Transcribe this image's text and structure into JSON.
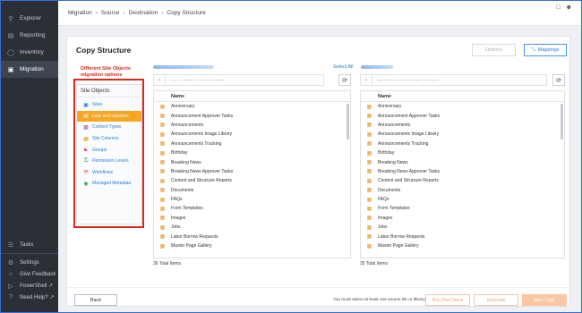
{
  "sidebar": {
    "top_items": [
      {
        "label": "Explorer",
        "icon": "search-icon"
      },
      {
        "label": "Reporting",
        "icon": "report-icon"
      },
      {
        "label": "Inventory",
        "icon": "inventory-icon"
      },
      {
        "label": "Migration",
        "icon": "migration-icon"
      }
    ],
    "bottom_items": [
      {
        "label": "Tasks",
        "icon": "tasks-icon"
      },
      {
        "label": "Settings",
        "icon": "gear-icon"
      },
      {
        "label": "Give Feedback",
        "icon": "feedback-icon"
      },
      {
        "label": "PowerShell ↗",
        "icon": "powershell-icon"
      },
      {
        "label": "Need Help? ↗",
        "icon": "help-icon"
      }
    ]
  },
  "breadcrumb": [
    "Migration",
    "Source",
    "Destination",
    "Copy Structure"
  ],
  "page": {
    "title": "Copy Structure",
    "options_label": "Options",
    "mappings_label": "Mappings",
    "annotation_line1": "Different Site Objects",
    "annotation_line2": "migration options"
  },
  "site_objects": {
    "header": "Site Objects",
    "items": [
      {
        "label": "Sites",
        "icon": "sites-icon"
      },
      {
        "label": "Lists and Libraries",
        "icon": "lists-icon"
      },
      {
        "label": "Content Types",
        "icon": "content-types-icon"
      },
      {
        "label": "Site Columns",
        "icon": "site-columns-icon"
      },
      {
        "label": "Groups",
        "icon": "groups-icon"
      },
      {
        "label": "Permission Levels",
        "icon": "key-icon"
      },
      {
        "label": "Workflows",
        "icon": "workflow-icon"
      },
      {
        "label": "Managed Metadata",
        "icon": "tag-icon"
      }
    ]
  },
  "source": {
    "select_all": "Select All",
    "column_header": "Name",
    "items": [
      "Anniversary",
      "Announcement Approver Tasks",
      "Announcements",
      "Announcements Image Library",
      "Announcements Tracking",
      "Birthday",
      "Breaking News",
      "Breaking News Approver Tasks",
      "Content and Structure Reports",
      "Documents",
      "FAQs",
      "Form Templates",
      "Images",
      "Jobs",
      "Labor Borrow Requests",
      "Master Page Gallery"
    ],
    "total": "36 Total Items"
  },
  "destination": {
    "column_header": "Name",
    "items": [
      "Anniversary",
      "Announcement Approver Tasks",
      "Announcements",
      "Announcements Image Library",
      "Announcements Tracking",
      "Birthday",
      "Breaking News",
      "Breaking News Approver Tasks",
      "Content and Structure Reports",
      "Documents",
      "FAQs",
      "Form Templates",
      "Images",
      "Jobs",
      "Labor Borrow Requests",
      "Master Page Gallery"
    ],
    "total": "35 Total Items"
  },
  "footer": {
    "back_label": "Back",
    "message": "You must select at least one source list or library.",
    "pre_check_label": "Run Pre-Check",
    "schedule_label": "Schedule",
    "start_label": "Start Copy"
  },
  "colors": {
    "accent": "#2f7bd8",
    "active_item": "#f5a623",
    "annotation": "#e0261c",
    "sidebar": "#2b2f36"
  }
}
